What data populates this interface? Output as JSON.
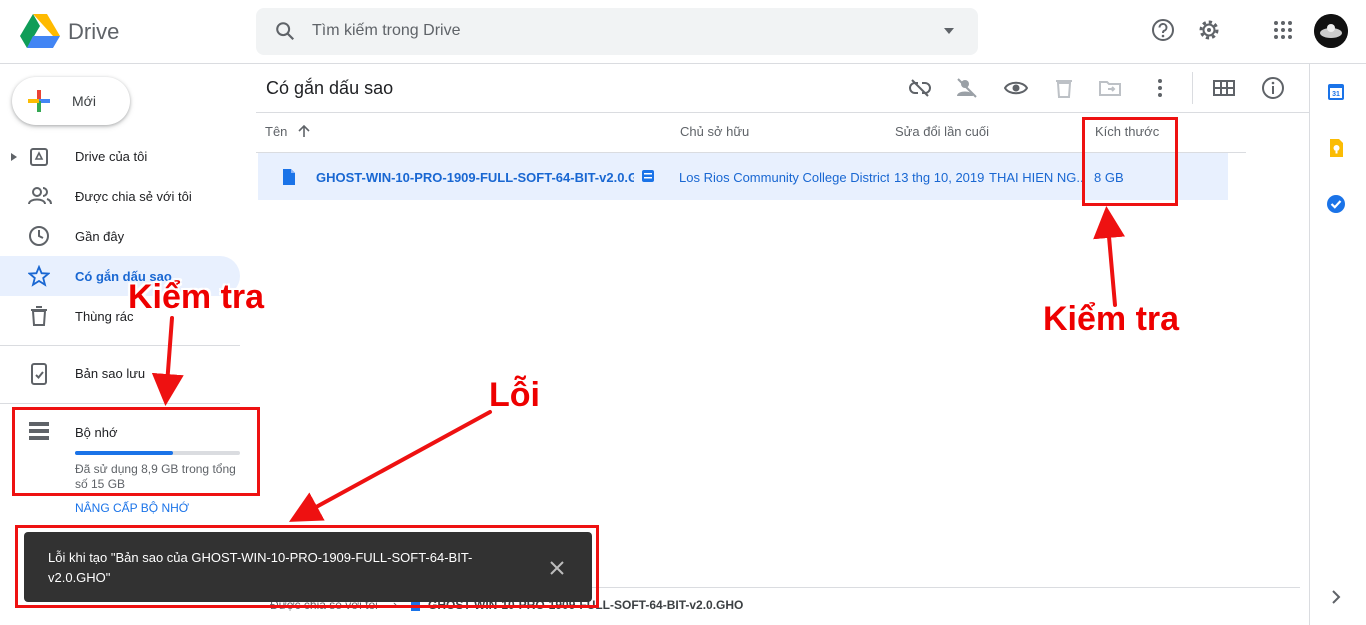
{
  "header": {
    "brand": "Drive",
    "search_placeholder": "Tìm kiếm trong Drive"
  },
  "sidebar": {
    "new_label": "Mới",
    "items": [
      {
        "label": "Drive của tôi",
        "icon": "my-drive-icon"
      },
      {
        "label": "Được chia sẻ với tôi",
        "icon": "shared-icon"
      },
      {
        "label": "Gần đây",
        "icon": "clock-icon"
      },
      {
        "label": "Có gắn dấu sao",
        "icon": "star-icon",
        "active": true
      },
      {
        "label": "Thùng rác",
        "icon": "trash-icon"
      },
      {
        "label": "Bản sao lưu",
        "icon": "backup-icon"
      }
    ],
    "storage": {
      "label": "Bộ nhớ",
      "usage_text": "Đã sử dụng 8,9 GB trong tổng số 15 GB",
      "used_fraction": 0.593,
      "upgrade_label": "NÂNG CẤP BỘ NHỚ"
    }
  },
  "main": {
    "title": "Có gắn dấu sao",
    "columns": [
      "Tên",
      "Chủ sở hữu",
      "Sửa đổi lần cuối",
      "Kích thước"
    ],
    "files": [
      {
        "name": "GHOST-WIN-10-PRO-1909-FULL-SOFT-64-BIT-v2.0.GHO",
        "name_display": "GHOST-WIN-10-PRO-1909-FULL-SOFT-64-BIT-v2.0.G...",
        "owner": "Los Rios Community College District",
        "modified": "13 thg 10, 2019",
        "modified_by": "THAI HIEN NG...",
        "size": "8 GB"
      }
    ],
    "breadcrumb": {
      "parent": "Được chia sẻ với tôi",
      "separator": "›",
      "file": "GHOST-WIN-10-PRO-1909-FULL-SOFT-64-BIT-v2.0.GHO"
    }
  },
  "snackbar": {
    "message": "Lỗi khi tạo \"Bản sao của GHOST-WIN-10-PRO-1909-FULL-SOFT-64-BIT-v2.0.GHO\""
  },
  "annotations": {
    "check_sidebar": "Kiểm tra",
    "check_size": "Kiểm tra",
    "error": "Lỗi",
    "color": "#ee1111"
  },
  "colors": {
    "accent": "#1a73e8",
    "active_bg": "#e8f0fe",
    "snackbar_bg": "#323232"
  }
}
